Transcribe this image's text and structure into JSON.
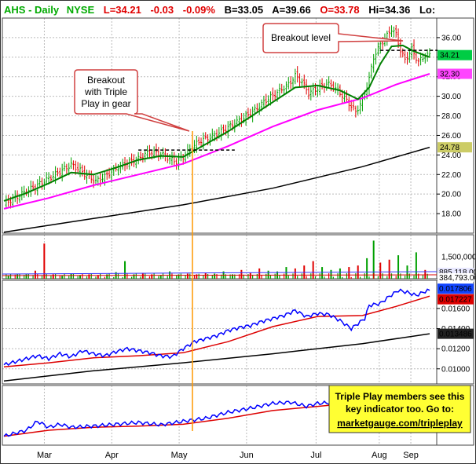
{
  "header": {
    "symbol": "AHS",
    "interval": "Daily",
    "exchange": "NYSE",
    "last": "L=34.21",
    "change": "-0.03",
    "change_pct": "-0.09%",
    "bid": "B=33.05",
    "ask": "A=39.66",
    "open": "O=33.78",
    "high": "Hi=34.36",
    "low": "Lo:"
  },
  "callouts": {
    "breakout_triple": [
      "Breakout",
      "with Triple",
      "Play in gear"
    ],
    "breakout_level": "Breakout level"
  },
  "promo": {
    "lines": [
      "Triple Play members see this",
      "key indicator too. Go to:"
    ],
    "link": "marketgauge.com/tripleplay"
  },
  "colors": {
    "up": "#00a000",
    "down": "#e00000",
    "ma_short": "#008000",
    "ma_mid": "#ff00ff",
    "ma_long": "#000000",
    "rs_line": "#0000ff",
    "rs_ma": "#dd0000",
    "marker": "#ff9900",
    "price_label_bg": "#00cc44",
    "ma_mid_label_bg": "#ff44ff",
    "ma_long_label_bg": "#cccc66",
    "rs_label_bg": "#1144ff",
    "rs_ma_label_bg": "#dd0000",
    "rs_long_label_bg": "#222222",
    "promo_bg": "#ffff33"
  },
  "chart_data": [
    {
      "type": "line",
      "panel": "price",
      "x_labels": [
        "Mar",
        "Apr",
        "May",
        "Jun",
        "Jul",
        "Aug",
        "Sep"
      ],
      "y_ticks": [
        "36.00",
        "34.00",
        "32.00",
        "30.00",
        "28.00",
        "26.00",
        "24.00",
        "22.00",
        "20.00",
        "18.00"
      ],
      "ylim": [
        16,
        38
      ],
      "price_path": [
        [
          0,
          19.0
        ],
        [
          5,
          19.6
        ],
        [
          10,
          20.3
        ],
        [
          15,
          20.9
        ],
        [
          20,
          21.6
        ],
        [
          25,
          22.3
        ],
        [
          30,
          23.0
        ],
        [
          33,
          22.6
        ],
        [
          37,
          21.9
        ],
        [
          41,
          21.3
        ],
        [
          45,
          21.8
        ],
        [
          50,
          22.6
        ],
        [
          55,
          23.2
        ],
        [
          60,
          23.6
        ],
        [
          63,
          24.1
        ],
        [
          66,
          24.3
        ],
        [
          70,
          24.1
        ],
        [
          74,
          23.6
        ],
        [
          77,
          23.3
        ],
        [
          80,
          23.8
        ],
        [
          84,
          24.8
        ],
        [
          88,
          25.5
        ],
        [
          92,
          25.8
        ],
        [
          97,
          26.4
        ],
        [
          102,
          27.1
        ],
        [
          107,
          27.8
        ],
        [
          112,
          28.6
        ],
        [
          117,
          29.6
        ],
        [
          122,
          30.4
        ],
        [
          127,
          31.2
        ],
        [
          130,
          32.1
        ],
        [
          133,
          31.5
        ],
        [
          136,
          30.3
        ],
        [
          140,
          30.8
        ],
        [
          144,
          31.3
        ],
        [
          147,
          31.0
        ],
        [
          151,
          30.1
        ],
        [
          155,
          29.0
        ],
        [
          157,
          28.4
        ],
        [
          160,
          29.6
        ],
        [
          163,
          31.8
        ],
        [
          165,
          34.0
        ],
        [
          168,
          35.3
        ],
        [
          171,
          36.2
        ],
        [
          173,
          36.9
        ],
        [
          175,
          36.3
        ],
        [
          177,
          34.7
        ],
        [
          179,
          33.7
        ],
        [
          182,
          34.8
        ],
        [
          185,
          33.5
        ],
        [
          188,
          34.2
        ],
        [
          190,
          34.21
        ]
      ],
      "ma_short": [
        [
          0,
          19.3
        ],
        [
          10,
          20.1
        ],
        [
          20,
          21.1
        ],
        [
          30,
          22.2
        ],
        [
          40,
          22.0
        ],
        [
          50,
          22.7
        ],
        [
          60,
          23.5
        ],
        [
          70,
          23.9
        ],
        [
          80,
          23.8
        ],
        [
          90,
          25.1
        ],
        [
          100,
          26.4
        ],
        [
          110,
          27.9
        ],
        [
          120,
          29.4
        ],
        [
          130,
          30.9
        ],
        [
          140,
          31.1
        ],
        [
          150,
          30.6
        ],
        [
          158,
          29.7
        ],
        [
          163,
          30.9
        ],
        [
          168,
          33.3
        ],
        [
          173,
          35.1
        ],
        [
          178,
          35.2
        ],
        [
          183,
          34.6
        ],
        [
          190,
          34.0
        ]
      ],
      "ma_mid": [
        [
          0,
          18.5
        ],
        [
          20,
          19.6
        ],
        [
          40,
          20.9
        ],
        [
          60,
          22.0
        ],
        [
          80,
          23.1
        ],
        [
          100,
          24.9
        ],
        [
          120,
          26.9
        ],
        [
          140,
          28.6
        ],
        [
          160,
          29.8
        ],
        [
          175,
          31.2
        ],
        [
          190,
          32.3
        ]
      ],
      "ma_long": [
        [
          0,
          16.1
        ],
        [
          40,
          17.5
        ],
        [
          80,
          18.9
        ],
        [
          120,
          20.6
        ],
        [
          160,
          22.8
        ],
        [
          190,
          24.78
        ]
      ],
      "breakout_levels": [
        {
          "from": 60,
          "to": 103,
          "value": 24.5
        },
        {
          "from": 168,
          "to": 190,
          "value": 34.7
        }
      ],
      "price_labels": [
        "34.21",
        "32.30",
        "24.78"
      ]
    },
    {
      "type": "bar",
      "panel": "volume",
      "y_ticks": [
        "1,500,000"
      ],
      "ylim": [
        0,
        3000000
      ],
      "overlay_labels": [
        "885,118.00",
        "384,793.00"
      ],
      "volume": [
        [
          2,
          0.2
        ],
        [
          6,
          0.3
        ],
        [
          10,
          0.3
        ],
        [
          14,
          0.55
        ],
        [
          18,
          2.4
        ],
        [
          22,
          0.3
        ],
        [
          26,
          0.2
        ],
        [
          30,
          0.35
        ],
        [
          34,
          0.25
        ],
        [
          38,
          0.3
        ],
        [
          42,
          0.25
        ],
        [
          46,
          0.3
        ],
        [
          50,
          0.45
        ],
        [
          54,
          1.2
        ],
        [
          58,
          0.3
        ],
        [
          62,
          0.4
        ],
        [
          66,
          0.3
        ],
        [
          70,
          0.25
        ],
        [
          74,
          0.5
        ],
        [
          78,
          0.3
        ],
        [
          82,
          0.35
        ],
        [
          86,
          0.3
        ],
        [
          90,
          0.4
        ],
        [
          94,
          0.35
        ],
        [
          98,
          0.5
        ],
        [
          102,
          0.3
        ],
        [
          106,
          0.6
        ],
        [
          110,
          0.4
        ],
        [
          114,
          0.7
        ],
        [
          118,
          0.55
        ],
        [
          122,
          0.5
        ],
        [
          126,
          0.8
        ],
        [
          130,
          0.7
        ],
        [
          134,
          0.9
        ],
        [
          138,
          1.2
        ],
        [
          142,
          0.8
        ],
        [
          146,
          0.6
        ],
        [
          150,
          0.7
        ],
        [
          154,
          0.8
        ],
        [
          158,
          0.9
        ],
        [
          162,
          1.4
        ],
        [
          165,
          2.6
        ],
        [
          168,
          1.1
        ],
        [
          172,
          1.3
        ],
        [
          176,
          1.6
        ],
        [
          180,
          0.9
        ],
        [
          184,
          1.8
        ],
        [
          188,
          0.6
        ]
      ]
    },
    {
      "type": "line",
      "panel": "indicator",
      "y_ticks": [
        "0.01600",
        "0.01400",
        "0.01200",
        "0.01000"
      ],
      "ylim": [
        0.0085,
        0.0188
      ],
      "labels": [
        "0.017806",
        "0.017227",
        "0.013486"
      ],
      "rs_line": [
        [
          0,
          0.0104
        ],
        [
          5,
          0.0107
        ],
        [
          10,
          0.011
        ],
        [
          15,
          0.0113
        ],
        [
          20,
          0.011
        ],
        [
          25,
          0.0115
        ],
        [
          30,
          0.0112
        ],
        [
          35,
          0.0118
        ],
        [
          40,
          0.0115
        ],
        [
          45,
          0.0113
        ],
        [
          50,
          0.0117
        ],
        [
          55,
          0.012
        ],
        [
          60,
          0.0118
        ],
        [
          65,
          0.0116
        ],
        [
          70,
          0.0113
        ],
        [
          75,
          0.0112
        ],
        [
          80,
          0.012
        ],
        [
          85,
          0.0127
        ],
        [
          90,
          0.013
        ],
        [
          95,
          0.0133
        ],
        [
          100,
          0.0138
        ],
        [
          105,
          0.0141
        ],
        [
          110,
          0.0143
        ],
        [
          115,
          0.0147
        ],
        [
          120,
          0.015
        ],
        [
          125,
          0.0153
        ],
        [
          130,
          0.0158
        ],
        [
          135,
          0.0152
        ],
        [
          140,
          0.0155
        ],
        [
          145,
          0.0154
        ],
        [
          150,
          0.0148
        ],
        [
          155,
          0.014
        ],
        [
          158,
          0.0145
        ],
        [
          161,
          0.015
        ],
        [
          163,
          0.0163
        ],
        [
          168,
          0.0165
        ],
        [
          172,
          0.0172
        ],
        [
          176,
          0.0178
        ],
        [
          180,
          0.0176
        ],
        [
          184,
          0.0173
        ],
        [
          188,
          0.0177
        ],
        [
          190,
          0.017806
        ]
      ],
      "rs_ma": [
        [
          0,
          0.0102
        ],
        [
          20,
          0.0106
        ],
        [
          40,
          0.0111
        ],
        [
          60,
          0.0113
        ],
        [
          80,
          0.0116
        ],
        [
          100,
          0.0127
        ],
        [
          120,
          0.0142
        ],
        [
          140,
          0.0152
        ],
        [
          160,
          0.0153
        ],
        [
          175,
          0.0162
        ],
        [
          190,
          0.017227
        ]
      ],
      "rs_long": [
        [
          0,
          0.0088
        ],
        [
          40,
          0.0098
        ],
        [
          80,
          0.0106
        ],
        [
          120,
          0.0115
        ],
        [
          160,
          0.0125
        ],
        [
          190,
          0.013486
        ]
      ]
    },
    {
      "type": "line",
      "panel": "lower",
      "ylim": [
        0,
        1
      ],
      "line_a": [
        [
          0,
          0.15
        ],
        [
          10,
          0.25
        ],
        [
          15,
          0.4
        ],
        [
          20,
          0.3
        ],
        [
          25,
          0.35
        ],
        [
          30,
          0.3
        ],
        [
          40,
          0.32
        ],
        [
          50,
          0.35
        ],
        [
          60,
          0.38
        ],
        [
          70,
          0.34
        ],
        [
          80,
          0.4
        ],
        [
          90,
          0.45
        ],
        [
          100,
          0.55
        ],
        [
          110,
          0.62
        ],
        [
          120,
          0.7
        ],
        [
          128,
          0.72
        ],
        [
          135,
          0.65
        ],
        [
          140,
          0.7
        ],
        [
          150,
          0.72
        ],
        [
          160,
          0.75
        ],
        [
          170,
          0.8
        ],
        [
          180,
          0.82
        ],
        [
          190,
          0.84
        ]
      ],
      "line_b": [
        [
          0,
          0.15
        ],
        [
          20,
          0.25
        ],
        [
          40,
          0.3
        ],
        [
          60,
          0.32
        ],
        [
          80,
          0.35
        ],
        [
          100,
          0.45
        ],
        [
          120,
          0.58
        ],
        [
          140,
          0.65
        ],
        [
          160,
          0.72
        ],
        [
          190,
          0.8
        ]
      ]
    }
  ]
}
